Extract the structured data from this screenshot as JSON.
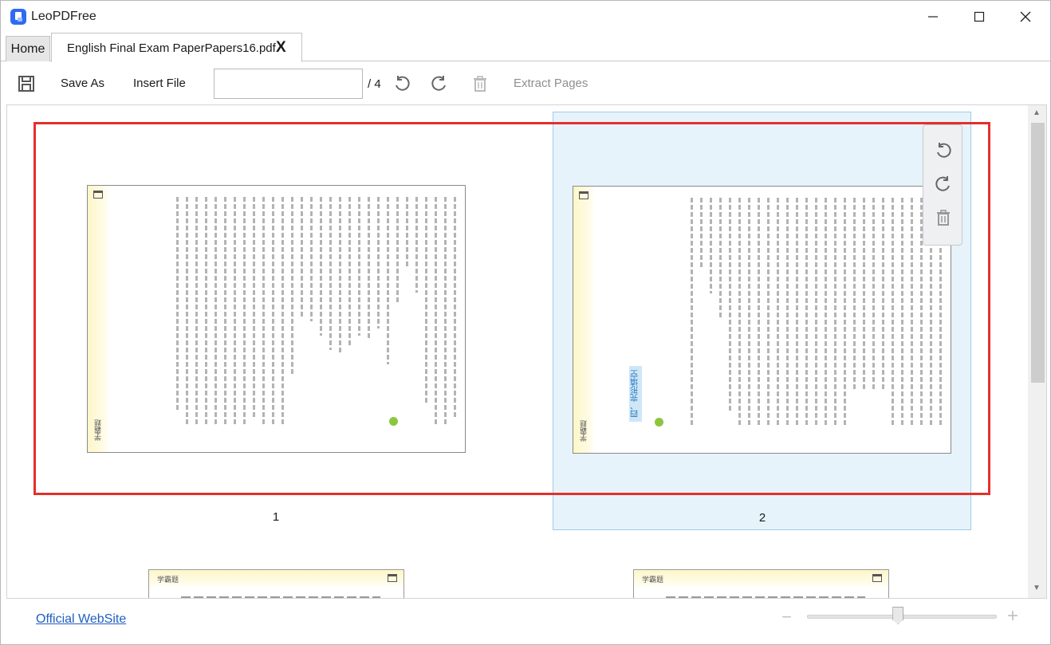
{
  "window": {
    "title": "LeoPDFree"
  },
  "tabs": {
    "home_label": "Home",
    "document_label": "English Final Exam PaperPapers16.pdf",
    "close_label": "X"
  },
  "toolbar": {
    "save_as_label": "Save As",
    "insert_file_label": "Insert File",
    "page_input_value": "",
    "page_total": "/ 4",
    "extract_pages_label": "Extract Pages"
  },
  "pages": [
    {
      "number": "1",
      "selected": false,
      "logo": "学霸题"
    },
    {
      "number": "2",
      "selected": true,
      "logo": "学霸题",
      "heading": "四、完形填空"
    }
  ],
  "peek_pages": [
    {
      "logo": "学霸题"
    },
    {
      "logo": "学霸题"
    }
  ],
  "footer": {
    "website_link": "Official WebSite",
    "zoom_minus": "−",
    "zoom_plus": "+",
    "zoom_level_fraction": 0.48
  },
  "colors": {
    "accent": "#2f6bf0",
    "selection_border": "#e4302b",
    "selected_page_bg": "#e7f3fb",
    "link": "#1f5fbf"
  },
  "icons": {
    "save": "save-icon",
    "rotate_left": "rotate-left-icon",
    "rotate_right": "rotate-right-icon",
    "delete": "trash-icon"
  }
}
